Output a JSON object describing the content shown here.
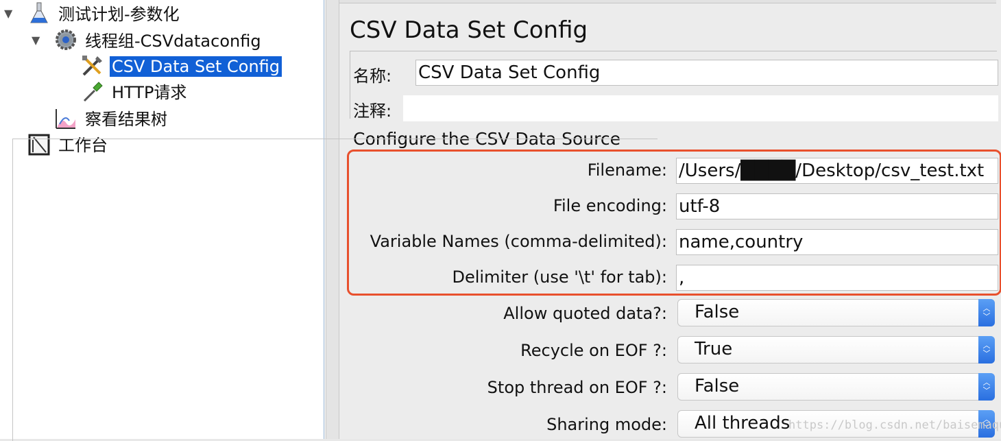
{
  "tree": {
    "items": [
      {
        "label": "测试计划-参数化"
      },
      {
        "label": "线程组-CSVdataconfig"
      },
      {
        "label": "CSV Data Set Config"
      },
      {
        "label": "HTTP请求"
      },
      {
        "label": "察看结果树"
      },
      {
        "label": "工作台"
      }
    ]
  },
  "panel": {
    "title": "CSV Data Set Config",
    "name_label": "名称:",
    "name_value": "CSV Data Set Config",
    "comment_label": "注释:",
    "comment_value": "",
    "group_title": "Configure the CSV Data Source",
    "fields": [
      {
        "label": "Filename:",
        "value": "/Users/████/Desktop/csv_test.txt"
      },
      {
        "label": "File encoding:",
        "value": "utf-8"
      },
      {
        "label": "Variable Names (comma-delimited):",
        "value": "name,country"
      },
      {
        "label": "Delimiter (use '\\t' for tab):",
        "value": ","
      }
    ],
    "selects": [
      {
        "label": "Allow quoted data?:",
        "value": "False"
      },
      {
        "label": "Recycle on EOF ?:",
        "value": "True"
      },
      {
        "label": "Stop thread on EOF ?:",
        "value": "False"
      },
      {
        "label": "Sharing mode:",
        "value": "All threads"
      }
    ]
  },
  "watermark": "https://blog.csdn.net/baisemaqu",
  "colors": {
    "selection": "#1160d6",
    "highlight": "#e8502d",
    "select_arrow": "#2a6fe0"
  }
}
